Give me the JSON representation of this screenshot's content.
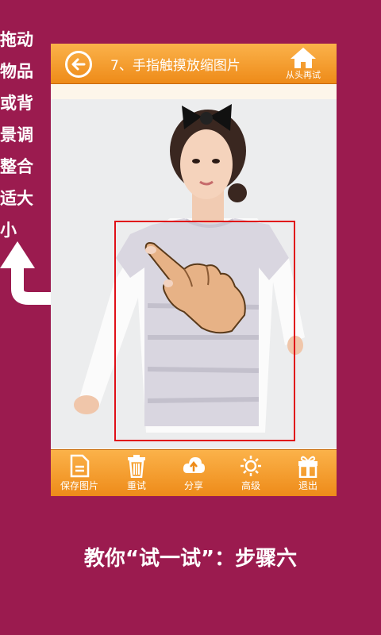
{
  "side_instruction": [
    "拖动",
    "物品",
    "或背",
    "景调",
    "整合",
    "适大",
    "小"
  ],
  "header": {
    "title": "7、手指触摸放缩图片",
    "restart_label": "从头再试"
  },
  "toolbar": {
    "items": [
      {
        "label": "保存图片",
        "icon": "save-document-icon"
      },
      {
        "label": "重试",
        "icon": "trash-icon"
      },
      {
        "label": "分享",
        "icon": "cloud-upload-icon"
      },
      {
        "label": "高级",
        "icon": "sun-icon"
      },
      {
        "label": "退出",
        "icon": "gift-icon"
      }
    ]
  },
  "caption": "教你“试一试”：步骤六",
  "colors": {
    "background": "#9b1b4f",
    "bar": "#f29a26",
    "frame": "#e01018"
  }
}
